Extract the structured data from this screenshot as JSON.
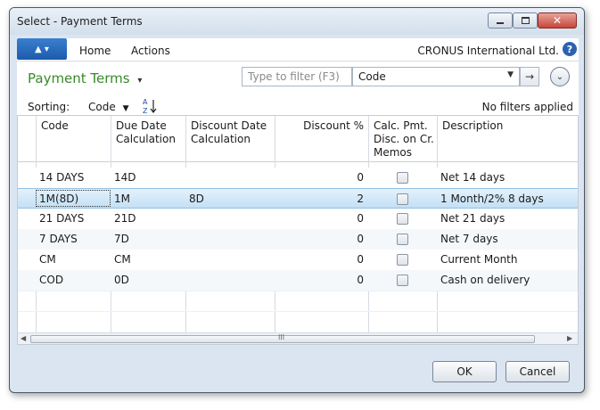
{
  "window": {
    "title": "Select - Payment Terms"
  },
  "ribbon": {
    "tabs": [
      "Home",
      "Actions"
    ],
    "company": "CRONUS International Ltd.",
    "help": "?"
  },
  "page": {
    "title": "Payment Terms",
    "title_arrow": "▾"
  },
  "filter": {
    "placeholder": "Type to filter (F3)",
    "field": "Code",
    "no_filters": "No filters applied"
  },
  "sorting": {
    "label": "Sorting:",
    "field": "Code"
  },
  "table": {
    "headers": {
      "code": "Code",
      "due": [
        "Due Date",
        "Calculation"
      ],
      "disc": [
        "Discount Date",
        "Calculation"
      ],
      "pct": "Discount %",
      "calc": [
        "Calc. Pmt.",
        "Disc. on Cr.",
        "Memos"
      ],
      "desc": "Description"
    },
    "rows": [
      {
        "code": "14 DAYS",
        "due": "14D",
        "disc": "",
        "pct": "0",
        "calc": false,
        "desc": "Net 14 days"
      },
      {
        "code": "1M(8D)",
        "due": "1M",
        "disc": "8D",
        "pct": "2",
        "calc": false,
        "desc": "1 Month/2% 8 days"
      },
      {
        "code": "21 DAYS",
        "due": "21D",
        "disc": "",
        "pct": "0",
        "calc": false,
        "desc": "Net 21 days"
      },
      {
        "code": "7 DAYS",
        "due": "7D",
        "disc": "",
        "pct": "0",
        "calc": false,
        "desc": "Net 7 days"
      },
      {
        "code": "CM",
        "due": "CM",
        "disc": "",
        "pct": "0",
        "calc": false,
        "desc": "Current Month"
      },
      {
        "code": "COD",
        "due": "0D",
        "disc": "",
        "pct": "0",
        "calc": false,
        "desc": "Cash on delivery"
      }
    ],
    "selected_row": 1
  },
  "buttons": {
    "ok": "OK",
    "cancel": "Cancel"
  }
}
